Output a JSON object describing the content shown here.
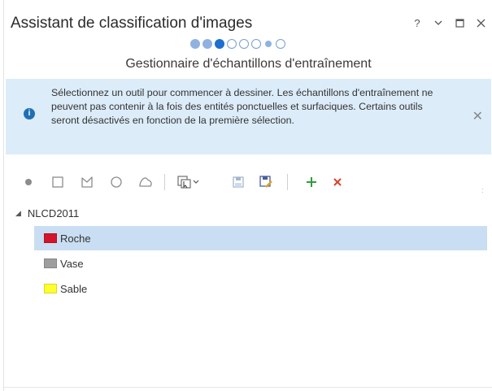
{
  "window": {
    "title": "Assistant de classification d'images",
    "help": "?",
    "menu": "⌄",
    "maximize": "□",
    "close": "✕"
  },
  "wizard": {
    "steps": [
      "done",
      "done",
      "current",
      "todo",
      "todo",
      "todo",
      "small",
      "todo"
    ],
    "page_title": "Gestionnaire d'échantillons d'entraînement"
  },
  "info_banner": {
    "icon": "info-icon",
    "text": "Sélectionnez un outil pour commencer à dessiner. Les échantillons d'entraînement ne peuvent pas contenir à la fois des entités ponctuelles et surfaciques. Certains outils seront désactivés en fonction de la première sélection.",
    "close": "✕"
  },
  "toolbar": {
    "tools": [
      "point-tool",
      "rectangle-tool",
      "polygon-tool",
      "circle-tool",
      "freehand-tool",
      "select-tool",
      "save-tool",
      "save-as-tool",
      "add-class-tool",
      "remove-class-tool"
    ]
  },
  "tree": {
    "root_label": "NLCD2011",
    "classes": [
      {
        "label": "Roche",
        "color": "#d2152a",
        "selected": true
      },
      {
        "label": "Vase",
        "color": "#9e9e9e",
        "selected": false
      },
      {
        "label": "Sable",
        "color": "#ffff2e",
        "selected": false
      }
    ]
  },
  "colors": {
    "accent": "#1e6fcf",
    "banner_bg": "#dcecf9",
    "selection": "#c9def2",
    "add": "#2e9e3a",
    "remove": "#d9412a"
  }
}
